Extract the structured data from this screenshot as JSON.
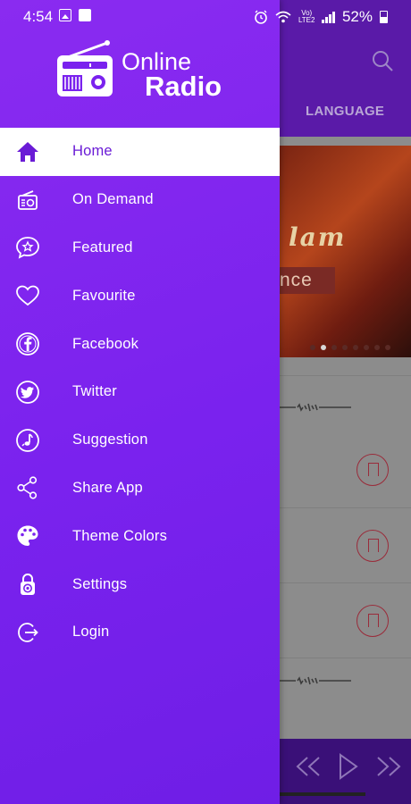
{
  "status_bar": {
    "time": "4:54",
    "battery_pct": "52%",
    "lte_label_top": "Vo)",
    "lte_label_bottom": "LTE2"
  },
  "app": {
    "logo_line1": "Online",
    "logo_line2": "Radio",
    "background_tab": "LANGUAGE",
    "banner_title": "lam",
    "banner_subtitle": "nce"
  },
  "menu": {
    "items": [
      {
        "label": "Home",
        "icon": "home-icon",
        "active": true
      },
      {
        "label": "On Demand",
        "icon": "radio-icon",
        "active": false
      },
      {
        "label": "Featured",
        "icon": "star-chat-icon",
        "active": false
      },
      {
        "label": "Favourite",
        "icon": "heart-icon",
        "active": false
      },
      {
        "label": "Facebook",
        "icon": "facebook-icon",
        "active": false
      },
      {
        "label": "Twitter",
        "icon": "twitter-icon",
        "active": false
      },
      {
        "label": "Suggestion",
        "icon": "suggestion-icon",
        "active": false
      },
      {
        "label": "Share App",
        "icon": "share-icon",
        "active": false
      },
      {
        "label": "Theme Colors",
        "icon": "palette-icon",
        "active": false
      },
      {
        "label": "Settings",
        "icon": "settings-icon",
        "active": false
      },
      {
        "label": "Login",
        "icon": "login-icon",
        "active": false
      }
    ]
  },
  "colors": {
    "drawer": "#7a22ee",
    "active_text": "#6a1bd6",
    "app_bar": "#5a1aa8"
  }
}
